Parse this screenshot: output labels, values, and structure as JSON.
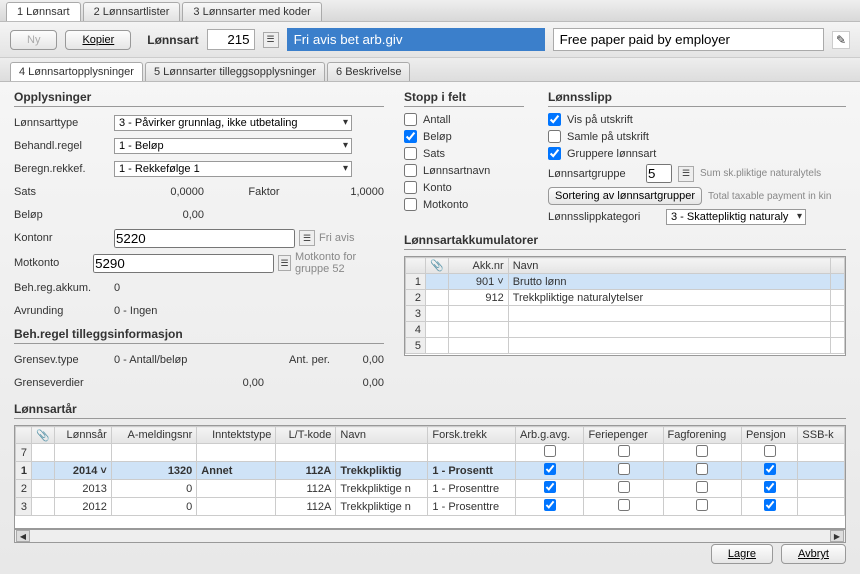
{
  "topTabs": [
    "1 Lønnsart",
    "2 Lønnsartlister",
    "3 Lønnsarter med koder"
  ],
  "toolbar": {
    "new_label": "Ny",
    "copy_label": "Kopier",
    "lonnsart_label": "Lønnsart",
    "code": "215",
    "name": "Fri avis bet arb.giv",
    "name_en": "Free paper paid by employer"
  },
  "subTabs": [
    "4 Lønnsartopplysninger",
    "5 Lønnsarter tilleggsopplysninger",
    "6 Beskrivelse"
  ],
  "opplysninger": {
    "title": "Opplysninger",
    "lonnsarttype_label": "Lønnsarttype",
    "lonnsarttype": "3 - Påvirker grunnlag, ikke utbetaling",
    "behandl_label": "Behandl.regel",
    "behandl": "1 - Beløp",
    "beregn_label": "Beregn.rekkef.",
    "beregn": "1 - Rekkefølge 1",
    "sats_label": "Sats",
    "sats": "0,0000",
    "faktor_label": "Faktor",
    "faktor": "1,0000",
    "belop_label": "Beløp",
    "belop": "0,00",
    "kontonr_label": "Kontonr",
    "kontonr": "5220",
    "kontonr_text": "Fri avis",
    "motkonto_label": "Motkonto",
    "motkonto": "5290",
    "motkonto_text": "Motkonto for gruppe 52",
    "behreg_label": "Beh.reg.akkum.",
    "behreg": "0",
    "avrunding_label": "Avrunding",
    "avrunding": "0 - Ingen"
  },
  "behregel": {
    "title": "Beh.regel tilleggsinformasjon",
    "grensev_label": "Grensev.type",
    "grensev": "0 - Antall/beløp",
    "antper_label": "Ant. per.",
    "antper": "0,00",
    "grenseverdier_label": "Grenseverdier",
    "grenseverdier": "0,00",
    "grenseverdier2": "0,00"
  },
  "stopp": {
    "title": "Stopp i felt",
    "antall": "Antall",
    "belop": "Beløp",
    "sats": "Sats",
    "lonnsartnavn": "Lønnsartnavn",
    "konto": "Konto",
    "motkonto": "Motkonto"
  },
  "lonnsslipp": {
    "title": "Lønnsslipp",
    "vis": "Vis på utskrift",
    "samle": "Samle på utskrift",
    "gruppere": "Gruppere lønnsart",
    "gruppe_label": "Lønnsartgruppe",
    "gruppe": "5",
    "gruppe_hint": "Sum sk.pliktige naturalytels",
    "sortering": "Sortering av lønnsartgrupper",
    "sortering_hint": "Total taxable payment in kin",
    "kategori_label": "Lønnsslippkategori",
    "kategori": "3 - Skattepliktig naturaly"
  },
  "akk": {
    "title": "Lønnsartakkumulatorer",
    "col_attach": "📎",
    "col_nr": "Akk.nr",
    "col_navn": "Navn",
    "rows": [
      {
        "nr": "901",
        "navn": "Brutto lønn"
      },
      {
        "nr": "912",
        "navn": "Trekkpliktige naturalytelser"
      }
    ]
  },
  "year": {
    "title": "Lønnsartår",
    "cols": [
      "",
      "",
      "Lønnsår",
      "A-meldingsnr",
      "Inntektstype",
      "L/T-kode",
      "Navn",
      "Forsk.trekk",
      "Arb.g.avg.",
      "Feriepenger",
      "Fagforening",
      "Pensjon",
      "SSB-k"
    ],
    "rows": [
      {
        "idx": "7",
        "year": "",
        "ameld": "",
        "itype": "",
        "lt": "",
        "navn": "",
        "f": false,
        "a": false,
        "fe": false,
        "fa": false,
        "p": false,
        "sel": false
      },
      {
        "idx": "1",
        "year": "2014",
        "ameld": "1320",
        "itype": "Annet",
        "lt": "112A",
        "navn": "Trekkpliktig",
        "ftxt": "1 - Prosentt",
        "f": true,
        "a": true,
        "fe": false,
        "fa": false,
        "p": true,
        "sel": true
      },
      {
        "idx": "2",
        "year": "2013",
        "ameld": "0",
        "itype": "",
        "lt": "112A",
        "navn": "Trekkpliktige n",
        "ftxt": "1 - Prosenttre",
        "f": true,
        "a": true,
        "fe": false,
        "fa": false,
        "p": true,
        "sel": false
      },
      {
        "idx": "3",
        "year": "2012",
        "ameld": "0",
        "itype": "",
        "lt": "112A",
        "navn": "Trekkpliktige n",
        "ftxt": "1 - Prosenttre",
        "f": true,
        "a": true,
        "fe": false,
        "fa": false,
        "p": true,
        "sel": false
      }
    ]
  },
  "footer": {
    "save": "Lagre",
    "cancel": "Avbryt"
  }
}
